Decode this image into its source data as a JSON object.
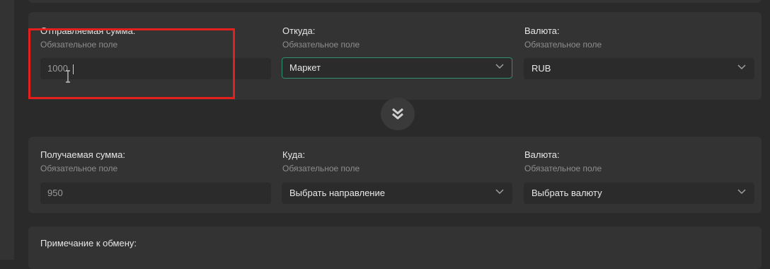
{
  "send": {
    "amount_label": "Отправляемая сумма:",
    "amount_hint": "Обязательное поле",
    "amount_value": "1000",
    "from_label": "Откуда:",
    "from_hint": "Обязательное поле",
    "from_value": "Маркет",
    "currency_label": "Валюта:",
    "currency_hint": "Обязательное поле",
    "currency_value": "RUB"
  },
  "receive": {
    "amount_label": "Получаемая сумма:",
    "amount_hint": "Обязательное поле",
    "amount_value": "950",
    "to_label": "Куда:",
    "to_hint": "Обязательное поле",
    "to_value": "Выбрать направление",
    "currency_label": "Валюта:",
    "currency_hint": "Обязательное поле",
    "currency_value": "Выбрать валюту"
  },
  "note": {
    "label": "Примечание к обмену:"
  },
  "icons": {
    "swap": "double-chevron-down-icon",
    "dropdown": "chevron-down-icon"
  },
  "colors": {
    "background": "#2a2a2a",
    "panel": "#333333",
    "input": "#2b2b2b",
    "focus_border": "#2f8f6e",
    "highlight": "#e51e1e"
  }
}
